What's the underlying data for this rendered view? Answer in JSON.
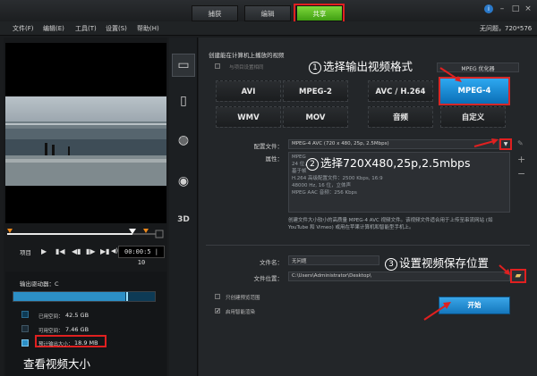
{
  "titlebar": {
    "tabs": [
      {
        "label": "捕获"
      },
      {
        "label": "编辑"
      },
      {
        "label": "共享"
      }
    ],
    "window_buttons": [
      "info-icon",
      "minimize-icon",
      "maximize-icon",
      "close-icon"
    ]
  },
  "menubar": {
    "items": [
      "文件(F)",
      "编辑(E)",
      "工具(T)",
      "设置(S)",
      "帮助(H)"
    ],
    "project_info": "无问题，720*576"
  },
  "player": {
    "project_label": "项目",
    "timecode": "00:00:5 | 10",
    "controls": [
      "play-icon",
      "prev-icon",
      "step-back-icon",
      "step-forward-icon",
      "next-icon",
      "volume-icon"
    ]
  },
  "drive": {
    "label": "输出驱动器：C",
    "fill_fraction": 0.79,
    "legend": [
      {
        "label": "已用空间：",
        "value": "42.5 GB",
        "color": "#0d3a55"
      },
      {
        "label": "可用空间：",
        "value": "7.46 GB",
        "color": "#1c2b36"
      },
      {
        "label": "预计输出大小：",
        "value": "18.9 MB",
        "color": "#2c8fc6"
      }
    ]
  },
  "sidebar_icons": [
    "computer-icon",
    "mobile-device-icon",
    "web-icon",
    "disc-icon",
    "3d-icon"
  ],
  "share": {
    "header": "创建能在计算机上播放的视频",
    "checkbox_label": "与项目设置相同",
    "profile_combo": "MPEG 优化器",
    "formats": [
      {
        "label": "AVI"
      },
      {
        "label": "MPEG-2"
      },
      {
        "label": "AVC / H.264"
      },
      {
        "label": "MPEG-4"
      },
      {
        "label": "WMV"
      },
      {
        "label": "MOV"
      },
      {
        "label": "音频"
      },
      {
        "label": "自定义"
      }
    ],
    "selected_format": "MPEG-4",
    "profile_label": "配置文件：",
    "profile_value": "MPEG-4 AVC (720 x 480, 25p, 2.5Mbps)",
    "props_label": "属性：",
    "props_lines": [
      "MPEG-4 AVC",
      "24 位，720 x 480, 25p",
      "基于帧",
      "H.264 高级配置文件：2500 Kbps, 16:9",
      "48000 Hz, 16 位，立体声",
      "MPEG AAC 音频：256 Kbps"
    ],
    "description": "创建文件大小较小的高质量 MPEG-4 AVC 视频文件。该视频文件适合用于上传至串流网站 (如 YouTube 和 Vimeo) 或用在苹果计算机和智能型手机上。",
    "filename_label": "文件名：",
    "filename_value": "无问题",
    "location_label": "文件位置：",
    "location_value": "C:\\Users\\Administrator\\Desktop\\",
    "option1": "只创建预览范围",
    "option2": "启用智能渲染",
    "start_label": "开始"
  },
  "annotations": {
    "a1_num": "1",
    "a1": "选择输出视频格式",
    "a2_num": "2",
    "a2": "选择720X480,25p,2.5mbps",
    "a3_num": "3",
    "a3": "设置视频保存位置",
    "a4": "查看视频大小",
    "color": "#e02020"
  }
}
